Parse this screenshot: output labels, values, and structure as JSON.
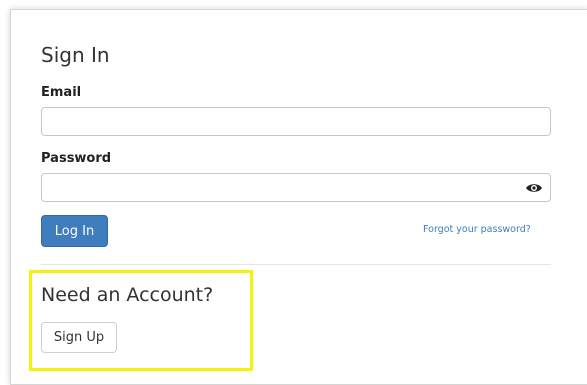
{
  "signin": {
    "title": "Sign In",
    "email_label": "Email",
    "email_value": "",
    "password_label": "Password",
    "password_value": "",
    "show_password_icon": "eye-icon",
    "login_button": "Log In",
    "forgot_link": "Forgot your password?"
  },
  "signup": {
    "title": "Need an Account?",
    "button": "Sign Up"
  },
  "colors": {
    "primary": "#3f7dbf",
    "highlight": "#f5f10a"
  }
}
